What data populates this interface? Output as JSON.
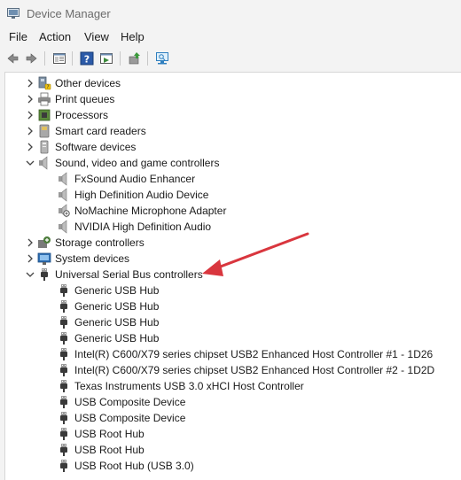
{
  "window": {
    "title": "Device Manager"
  },
  "menu": [
    {
      "label": "File"
    },
    {
      "label": "Action"
    },
    {
      "label": "View"
    },
    {
      "label": "Help"
    }
  ],
  "toolbar": {
    "buttons": [
      "back-icon",
      "forward-icon",
      "properties-pane-icon",
      "help-icon",
      "show-hide-icon",
      "update-driver-icon",
      "scan-hardware-icon"
    ]
  },
  "tree": {
    "other_devices": "Other devices",
    "print_queues": "Print queues",
    "processors": "Processors",
    "smart_card_readers": "Smart card readers",
    "software_devices": "Software devices",
    "sound_video_game": "Sound, video and game controllers",
    "audio": [
      "FxSound Audio Enhancer",
      "High Definition Audio Device",
      "NoMachine Microphone Adapter",
      "NVIDIA High Definition Audio"
    ],
    "storage_controllers": "Storage controllers",
    "system_devices": "System devices",
    "usb_controllers": "Universal Serial Bus controllers",
    "usb": [
      "Generic USB Hub",
      "Generic USB Hub",
      "Generic USB Hub",
      "Generic USB Hub",
      "Intel(R) C600/X79 series chipset USB2 Enhanced Host Controller #1 - 1D26",
      "Intel(R) C600/X79 series chipset USB2 Enhanced Host Controller #2 - 1D2D",
      "Texas Instruments USB 3.0 xHCI Host Controller",
      "USB Composite Device",
      "USB Composite Device",
      "USB Root Hub",
      "USB Root Hub",
      "USB Root Hub (USB 3.0)"
    ]
  },
  "colors": {
    "annotation_arrow": "#d9363e"
  }
}
